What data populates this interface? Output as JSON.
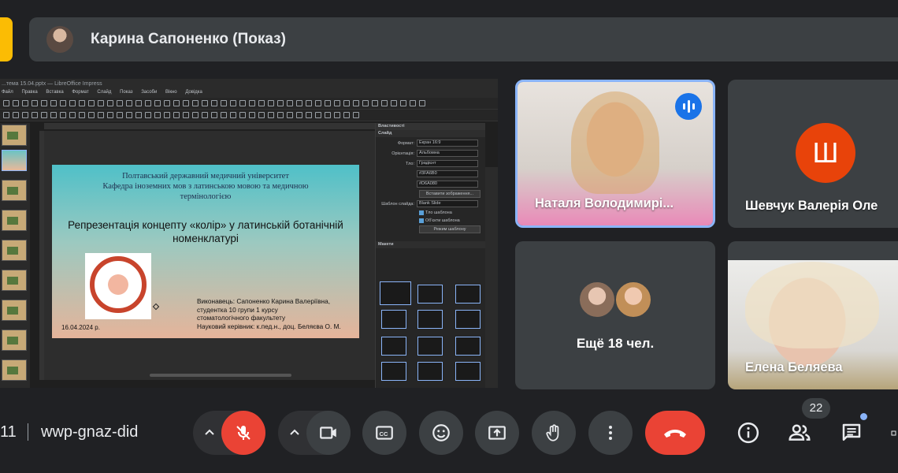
{
  "presenter": {
    "label": "Карина Сапоненко (Показ)"
  },
  "shared_screen": {
    "window_title": "...тема 15.04.pptx — LibreOffice Impress",
    "menu": [
      "Файл",
      "Правка",
      "Вставка",
      "Формат",
      "Слайд",
      "Показ",
      "Засоби",
      "Вікно",
      "Довідка"
    ],
    "slide": {
      "university": "Полтавський державний медичний університет",
      "department": "Кафедра іноземних мов з латинською мовою та медичною термінологією",
      "topic": "Репрезентація концепту «колір» у латинській ботанічній номенклатурі",
      "performer_line1": "Виконавець: Сапоненко Карина Валеріївна,",
      "performer_line2": "студентка 10 групи 1 курсу",
      "performer_line3": "стоматологічного факультету",
      "supervisor": "Науковий керівник: к.пед.н., доц. Беляєва О. М.",
      "date": "16.04.2024 р."
    },
    "properties": {
      "panel_title": "Властивості",
      "section_slide": "Слайд",
      "format_label": "Формат:",
      "format_value": "Екран 16:9",
      "orientation_label": "Орієнтація:",
      "orientation_value": "Альбомна",
      "background_label": "Тло:",
      "background_value": "Градієнт",
      "color1": "#3FA6B0",
      "color2": "#D6A080",
      "insert_image_button": "Вставити зображення...",
      "master_label": "Шаблон слайда:",
      "master_value": "Blank Slide",
      "check1": "Тло шаблона",
      "check2": "Об'єкти шаблона",
      "master_button": "Режим шаблону",
      "section_layouts": "Макети"
    }
  },
  "participants": [
    {
      "name": "Наталя Володимирі...",
      "speaking": true
    },
    {
      "name": "Шевчук Валерія Оле",
      "initial": "Ш",
      "avatar_color": "#e8430a"
    },
    {
      "more_label": "Ещё 18 чел."
    },
    {
      "name": "Елена Беляева"
    }
  ],
  "bottom_bar": {
    "time": "11",
    "meeting_code": "wwp-gnaz-did",
    "people_count": "22"
  },
  "colors": {
    "background": "#202124",
    "tile": "#3c4043",
    "accent_blue": "#8ab4f8",
    "speaking_blue": "#1a73e8",
    "danger_red": "#ea4335",
    "presenting_yellow": "#fbbc04"
  }
}
